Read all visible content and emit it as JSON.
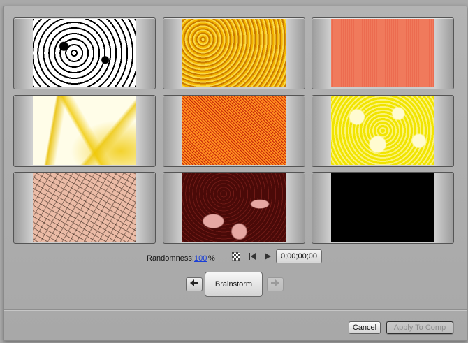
{
  "thumbnails": [
    {
      "pattern": "black-white-marble",
      "colors": [
        "#ffffff",
        "#000000"
      ]
    },
    {
      "pattern": "gold-noise",
      "colors": [
        "#f6c21a",
        "#b36a00"
      ]
    },
    {
      "pattern": "coral-flat",
      "colors": [
        "#f0775a",
        "#ee6f53"
      ]
    },
    {
      "pattern": "yellow-veins",
      "colors": [
        "#ffffff",
        "#f1c800"
      ]
    },
    {
      "pattern": "orange-speckle",
      "colors": [
        "#ff8a1c",
        "#b01f08"
      ]
    },
    {
      "pattern": "yellow-cells",
      "colors": [
        "#fdf46a",
        "#e2d500"
      ]
    },
    {
      "pattern": "pink-speckle",
      "colors": [
        "#eab9a3",
        "#3a2418"
      ]
    },
    {
      "pattern": "maroon-pink-marble",
      "colors": [
        "#4a0a08",
        "#e8a8a3"
      ]
    },
    {
      "pattern": "black",
      "colors": [
        "#000000",
        "#000000"
      ]
    }
  ],
  "controls": {
    "randomness_label": "Randomness:",
    "randomness_value": "100",
    "randomness_unit": "%",
    "timecode": "0;00;00;00",
    "icons": [
      "checkerboard-icon",
      "skip-to-start-icon",
      "play-icon"
    ]
  },
  "navigation": {
    "back_icon": "back-arrow-icon",
    "brainstorm_label": "Brainstorm",
    "forward_icon": "forward-arrow-icon"
  },
  "footer": {
    "cancel_label": "Cancel",
    "apply_label": "Apply To Comp"
  }
}
